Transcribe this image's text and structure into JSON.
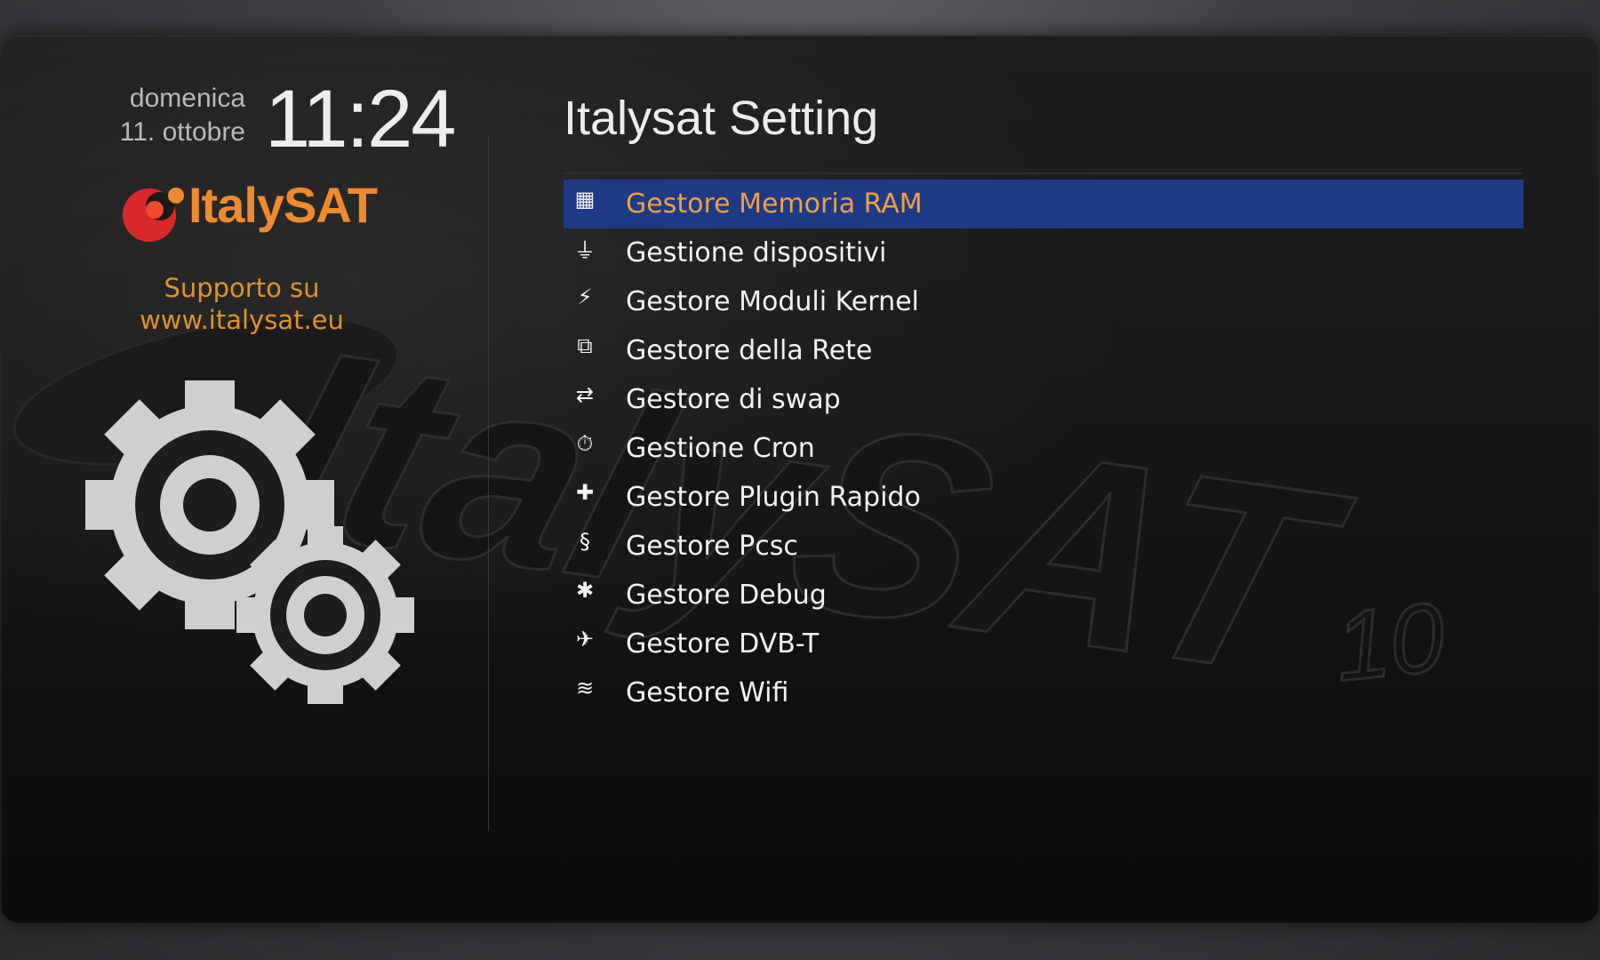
{
  "clock": {
    "weekday": "domenica",
    "date": "11. ottobre",
    "time": "11:24"
  },
  "brand": {
    "logo_text": "ItalySAT",
    "watermark_text": "ItalySAT",
    "watermark_version": "10"
  },
  "support": {
    "line1": "Supporto su",
    "line2": "www.italysat.eu"
  },
  "title": "Italysat Setting",
  "menu": {
    "selected_index": 0,
    "items": [
      {
        "label": "Gestore Memoria RAM",
        "icon": "memory-chip-icon",
        "glyph": "▦"
      },
      {
        "label": "Gestione dispositivi",
        "icon": "usb-icon",
        "glyph": "⏚"
      },
      {
        "label": "Gestore Moduli Kernel",
        "icon": "lightning-icon",
        "glyph": "⚡"
      },
      {
        "label": "Gestore della Rete",
        "icon": "network-icon",
        "glyph": "⧉"
      },
      {
        "label": "Gestore di swap",
        "icon": "swap-arrows-icon",
        "glyph": "⇄"
      },
      {
        "label": "Gestione Cron",
        "icon": "stopwatch-icon",
        "glyph": "⏱"
      },
      {
        "label": "Gestore Plugin Rapido",
        "icon": "puzzle-icon",
        "glyph": "✚"
      },
      {
        "label": "Gestore Pcsc",
        "icon": "card-reader-icon",
        "glyph": "§"
      },
      {
        "label": "Gestore Debug",
        "icon": "bug-icon",
        "glyph": "✱"
      },
      {
        "label": "Gestore DVB-T",
        "icon": "satellite-dish-icon",
        "glyph": "✈"
      },
      {
        "label": "Gestore Wifi",
        "icon": "wifi-icon",
        "glyph": "≋"
      }
    ]
  },
  "colors": {
    "accent": "#f08a2c",
    "selection": "#1f3a86",
    "text": "#f2f2f2",
    "logo_red": "#d8282a"
  }
}
